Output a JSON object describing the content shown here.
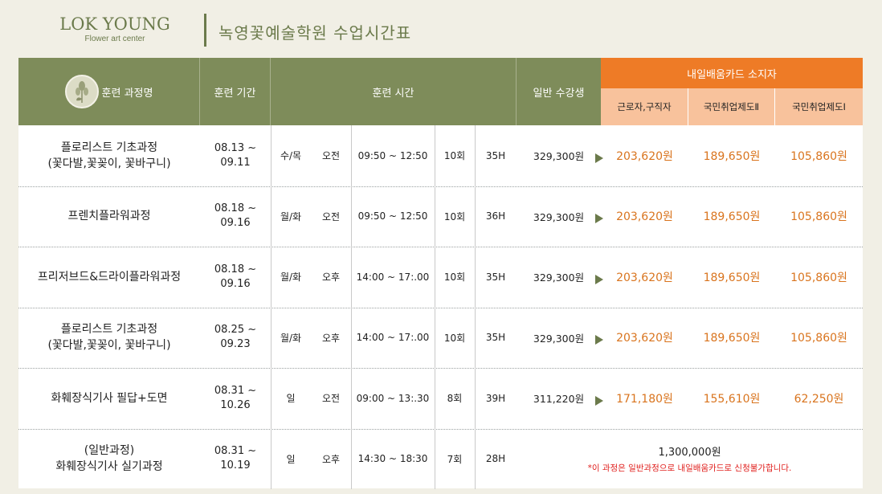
{
  "header": {
    "logo_main": "LOK YOUNG",
    "logo_sub": "Flower art center",
    "title": "녹영꽃예술학원 수업시간표"
  },
  "colors": {
    "green": "#7e8c5a",
    "orange": "#ee7b26",
    "peach": "#f8c29c",
    "price_orange": "#d9741e",
    "note_red": "#e0201e"
  },
  "table": {
    "headers": {
      "course": "훈련 과정명",
      "period": "훈련 기간",
      "time": "훈련 시간",
      "general": "일반 수강생",
      "card_group": "내일배움카드 소지자",
      "worker": "근로자,구직자",
      "natl2": "국민취업제도Ⅱ",
      "natl1": "국민취업제도Ⅰ"
    },
    "rows": [
      {
        "course1": "플로리스트 기초과정",
        "course2": "(꽃다발,꽃꽂이, 꽃바구니)",
        "period1": "08.13 ~",
        "period2": "09.11",
        "days": "수/목",
        "ampm": "오전",
        "time": "09:50 ~ 12:50",
        "sessions": "10회",
        "hours": "35H",
        "general": "329,300원",
        "worker": "203,620원",
        "natl2": "189,650원",
        "natl1": "105,860원"
      },
      {
        "course1": "프렌치플라워과정",
        "course2": "",
        "period1": "08.18 ~",
        "period2": "09.16",
        "days": "월/화",
        "ampm": "오전",
        "time": "09:50 ~ 12:50",
        "sessions": "10회",
        "hours": "36H",
        "general": "329,300원",
        "worker": "203,620원",
        "natl2": "189,650원",
        "natl1": "105,860원"
      },
      {
        "course1": "프리저브드&드라이플라워과정",
        "course2": "",
        "period1": "08.18 ~",
        "period2": "09.16",
        "days": "월/화",
        "ampm": "오후",
        "time": "14:00 ~ 17:.00",
        "sessions": "10회",
        "hours": "35H",
        "general": "329,300원",
        "worker": "203,620원",
        "natl2": "189,650원",
        "natl1": "105,860원"
      },
      {
        "course1": "플로리스트 기초과정",
        "course2": "(꽃다발,꽃꽂이, 꽃바구니)",
        "period1": "08.25 ~",
        "period2": "09.23",
        "days": "월/화",
        "ampm": "오후",
        "time": "14:00 ~ 17:.00",
        "sessions": "10회",
        "hours": "35H",
        "general": "329,300원",
        "worker": "203,620원",
        "natl2": "189,650원",
        "natl1": "105,860원"
      },
      {
        "course1": "화훼장식기사 필답+도면",
        "course2": "",
        "period1": "08.31 ~",
        "period2": "10.26",
        "days": "일",
        "ampm": "오전",
        "time": "09:00 ~ 13:.30",
        "sessions": "8회",
        "hours": "39H",
        "general": "311,220원",
        "worker": "171,180원",
        "natl2": "155,610원",
        "natl1": "62,250원"
      }
    ],
    "last_row": {
      "course1": "(일반과정)",
      "course2": "화훼장식기사 실기과정",
      "period1": "08.31 ~",
      "period2": "10.19",
      "days": "일",
      "ampm": "오후",
      "time": "14:30 ~ 18:30",
      "sessions": "7회",
      "hours": "28H",
      "total": "1,300,000원",
      "note": "*이 과정은 일반과정으로 내일배움카드로 신청불가합니다."
    }
  }
}
